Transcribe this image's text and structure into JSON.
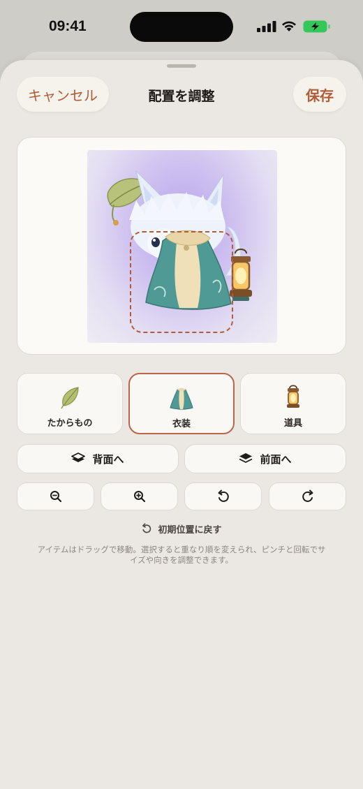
{
  "status_bar": {
    "time": "09:41"
  },
  "header": {
    "cancel_label": "キャンセル",
    "title": "配置を調整",
    "save_label": "保存"
  },
  "items": [
    {
      "label": "たからもの",
      "icon": "leaf-icon",
      "selected": false
    },
    {
      "label": "衣装",
      "icon": "cape-icon",
      "selected": true
    },
    {
      "label": "道具",
      "icon": "lantern-icon",
      "selected": false
    }
  ],
  "layer": {
    "back_label": "背面へ",
    "front_label": "前面へ"
  },
  "tools": [
    "zoom-out-icon",
    "zoom-in-icon",
    "rotate-left-icon",
    "rotate-right-icon"
  ],
  "reset_label": "初期位置に戻す",
  "help_text": "アイテムはドラッグで移動。選択すると重なり順を変えられ、ピンチと回転でサイズや向きを調整できます。",
  "colors": {
    "accent": "#b25b38",
    "sheet_bg": "#ebe8e3",
    "card_bg": "#faf8f4"
  }
}
